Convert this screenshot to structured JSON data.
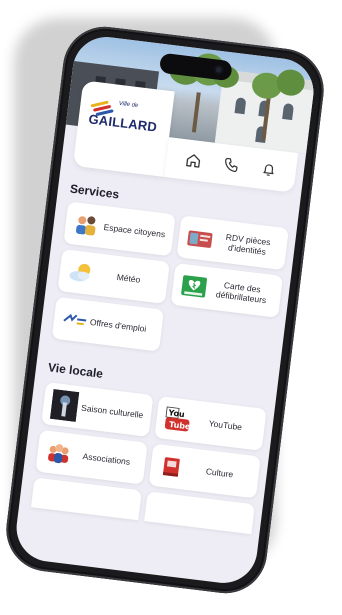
{
  "header": {
    "logo": {
      "prefix": "Ville de",
      "name": "GAILLARD"
    },
    "icons": [
      {
        "name": "home-icon"
      },
      {
        "name": "phone-icon"
      },
      {
        "name": "bell-icon"
      }
    ]
  },
  "sections": [
    {
      "title": "Services",
      "tiles": [
        {
          "label": "Espace citoyens",
          "icon": "family-icon"
        },
        {
          "label": "RDV pièces d'identités",
          "icon": "id-card-icon"
        },
        {
          "label": "Météo",
          "icon": "weather-icon"
        },
        {
          "label": "Carte des défibrillateurs",
          "icon": "defibrillator-icon"
        },
        {
          "label": "Offres d'emploi",
          "icon": "jobs-logo-icon"
        }
      ]
    },
    {
      "title": "Vie locale",
      "tiles": [
        {
          "label": "Saison culturelle",
          "icon": "stage-icon"
        },
        {
          "label": "YouTube",
          "icon": "youtube-icon"
        },
        {
          "label": "Associations",
          "icon": "people-icon"
        },
        {
          "label": "Culture",
          "icon": "book-icon"
        }
      ]
    }
  ],
  "colors": {
    "brand": "#1e2a6b",
    "background": "#eeedf5",
    "frame": "#1b1b1d"
  }
}
